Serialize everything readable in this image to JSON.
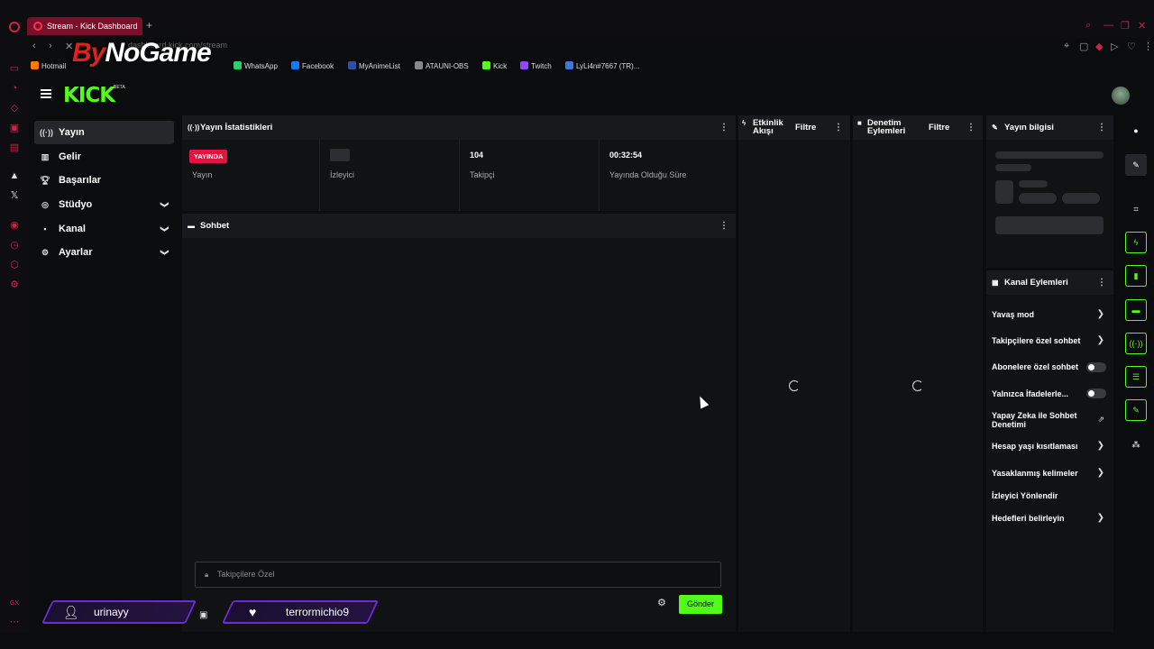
{
  "browser": {
    "tab_title": "Stream - Kick Dashboard",
    "new_tab": "+",
    "url": "dashboard.kick.com/stream",
    "bookmarks": [
      {
        "label": "Hotmail",
        "color": "#ff7b00"
      },
      {
        "label": "WhatsApp",
        "color": "#25d366"
      },
      {
        "label": "Facebook",
        "color": "#1877f2"
      },
      {
        "label": "MyAnimeList",
        "color": "#2e51a2"
      },
      {
        "label": "ATAUNI-OBS",
        "color": "#888888"
      },
      {
        "label": "Kick",
        "color": "#53fc18"
      },
      {
        "label": "Twitch",
        "color": "#9146ff"
      },
      {
        "label": "LyLi4n#7667 (TR)...",
        "color": "#3a7bd5"
      }
    ]
  },
  "watermark": {
    "text1": "By",
    "text2": "NoGame"
  },
  "topnav": {
    "logo": "KICK",
    "beta": "BETA"
  },
  "sidebar": {
    "items": [
      {
        "label": "Yayın",
        "icon": "broadcast-icon"
      },
      {
        "label": "Gelir",
        "icon": "revenue-icon"
      },
      {
        "label": "Başarılar",
        "icon": "trophy-icon"
      },
      {
        "label": "Stüdyo",
        "icon": "studio-icon"
      },
      {
        "label": "Kanal",
        "icon": "channel-icon"
      },
      {
        "label": "Ayarlar",
        "icon": "gear-icon"
      }
    ]
  },
  "stats": {
    "title": "Yayın İstatistikleri",
    "live_badge": "YAYINDA",
    "stream_label": "Yayın",
    "viewers_label": "İzleyici",
    "followers_value": "104",
    "followers_label": "Takipçi",
    "duration_value": "00:32:54",
    "duration_label": "Yayında Olduğu Süre"
  },
  "chat": {
    "title": "Sohbet",
    "input_placeholder": "Takipçilere Özel",
    "send_label": "Gönder",
    "badges": [
      {
        "name": "urinayy"
      },
      {
        "name": "terrormichio9"
      }
    ]
  },
  "activity": {
    "title_line1": "Etkinlik",
    "title_line2": "Akışı",
    "filter": "Filtre"
  },
  "moderation": {
    "title_line1": "Denetim",
    "title_line2": "Eylemleri",
    "filter": "Filtre"
  },
  "stream_info": {
    "title": "Yayın bilgisi"
  },
  "channel_actions": {
    "title": "Kanal Eylemleri",
    "items": [
      {
        "label": "Yavaş mod",
        "control": "arrow"
      },
      {
        "label": "Takipçilere özel sohbet",
        "control": "arrow"
      },
      {
        "label": "Abonelere özel sohbet",
        "control": "toggle"
      },
      {
        "label": "Yalnızca İfadelerle...",
        "control": "toggle"
      },
      {
        "label": "Yapay Zeka ile Sohbet Denetimi",
        "control": "external"
      },
      {
        "label": "Hesap yaşı kısıtlaması",
        "control": "arrow"
      },
      {
        "label": "Yasaklanmış kelimeler",
        "control": "arrow"
      },
      {
        "label": "İzleyici Yönlendir",
        "control": "none"
      },
      {
        "label": "Hedefleri belirleyin",
        "control": "arrow"
      }
    ]
  }
}
